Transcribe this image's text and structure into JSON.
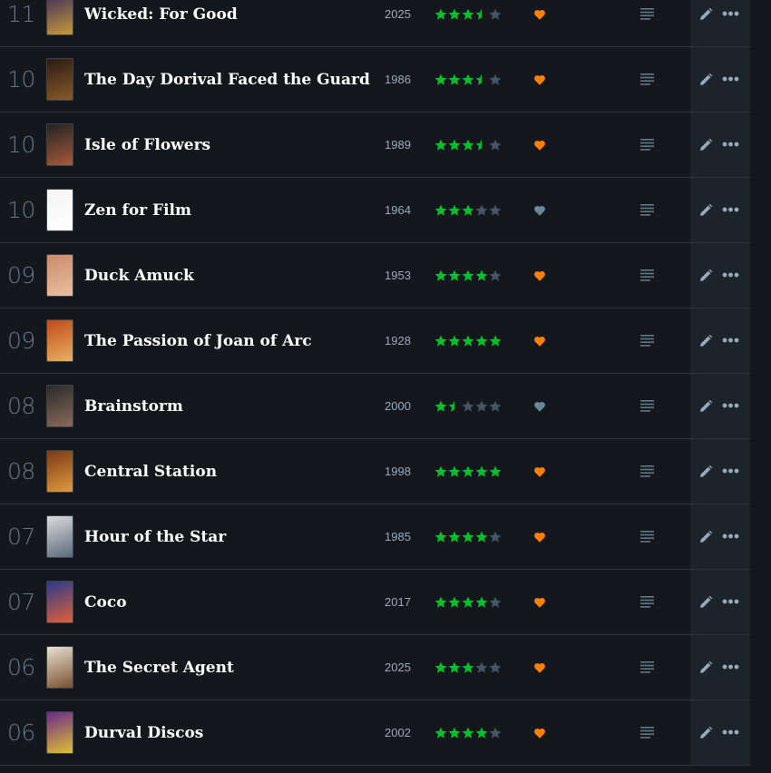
{
  "colors": {
    "background": "#14181c",
    "star_filled": "#00c030",
    "star_empty": "#445566",
    "like_on": "#ff8000",
    "like_off": "#678899",
    "text_title": "#ffffff",
    "text_muted": "#99aabb"
  },
  "icons": {
    "star": "star-icon",
    "heart": "heart-icon",
    "review": "review-lines-icon",
    "edit": "pencil-icon",
    "more": "ellipsis-icon"
  },
  "entries": [
    {
      "day": "11",
      "title": "Wicked: For Good",
      "year": "2025",
      "rating": 3.5,
      "liked": true,
      "poster": [
        "#3b2b5a",
        "#c89a3a"
      ]
    },
    {
      "day": "10",
      "title": "The Day Dorival Faced the Guard",
      "year": "1986",
      "rating": 3.5,
      "liked": true,
      "poster": [
        "#2a1a12",
        "#8a5a2a"
      ]
    },
    {
      "day": "10",
      "title": "Isle of Flowers",
      "year": "1989",
      "rating": 3.5,
      "liked": true,
      "poster": [
        "#222222",
        "#a85a3a"
      ]
    },
    {
      "day": "10",
      "title": "Zen for Film",
      "year": "1964",
      "rating": 3,
      "liked": false,
      "poster": [
        "#f4f4f4",
        "#ffffff"
      ]
    },
    {
      "day": "09",
      "title": "Duck Amuck",
      "year": "1953",
      "rating": 4,
      "liked": true,
      "poster": [
        "#c98a6a",
        "#e8c0a0"
      ]
    },
    {
      "day": "09",
      "title": "The Passion of Joan of Arc",
      "year": "1928",
      "rating": 5,
      "liked": true,
      "poster": [
        "#c04a1a",
        "#e8b060"
      ]
    },
    {
      "day": "08",
      "title": "Brainstorm",
      "year": "2000",
      "rating": 1.5,
      "liked": false,
      "poster": [
        "#2a2a2a",
        "#8a6a5a"
      ]
    },
    {
      "day": "08",
      "title": "Central Station",
      "year": "1998",
      "rating": 5,
      "liked": true,
      "poster": [
        "#7a3a14",
        "#e09a40"
      ]
    },
    {
      "day": "07",
      "title": "Hour of the Star",
      "year": "1985",
      "rating": 4,
      "liked": true,
      "poster": [
        "#dcdcdc",
        "#5a6a7a"
      ]
    },
    {
      "day": "07",
      "title": "Coco",
      "year": "2017",
      "rating": 4,
      "liked": true,
      "poster": [
        "#2a3a8a",
        "#e0603a"
      ]
    },
    {
      "day": "06",
      "title": "The Secret Agent",
      "year": "2025",
      "rating": 3,
      "liked": true,
      "poster": [
        "#e8e0d0",
        "#7a5030"
      ]
    },
    {
      "day": "06",
      "title": "Durval Discos",
      "year": "2002",
      "rating": 4,
      "liked": true,
      "poster": [
        "#6a2a8a",
        "#e0c030"
      ]
    }
  ]
}
